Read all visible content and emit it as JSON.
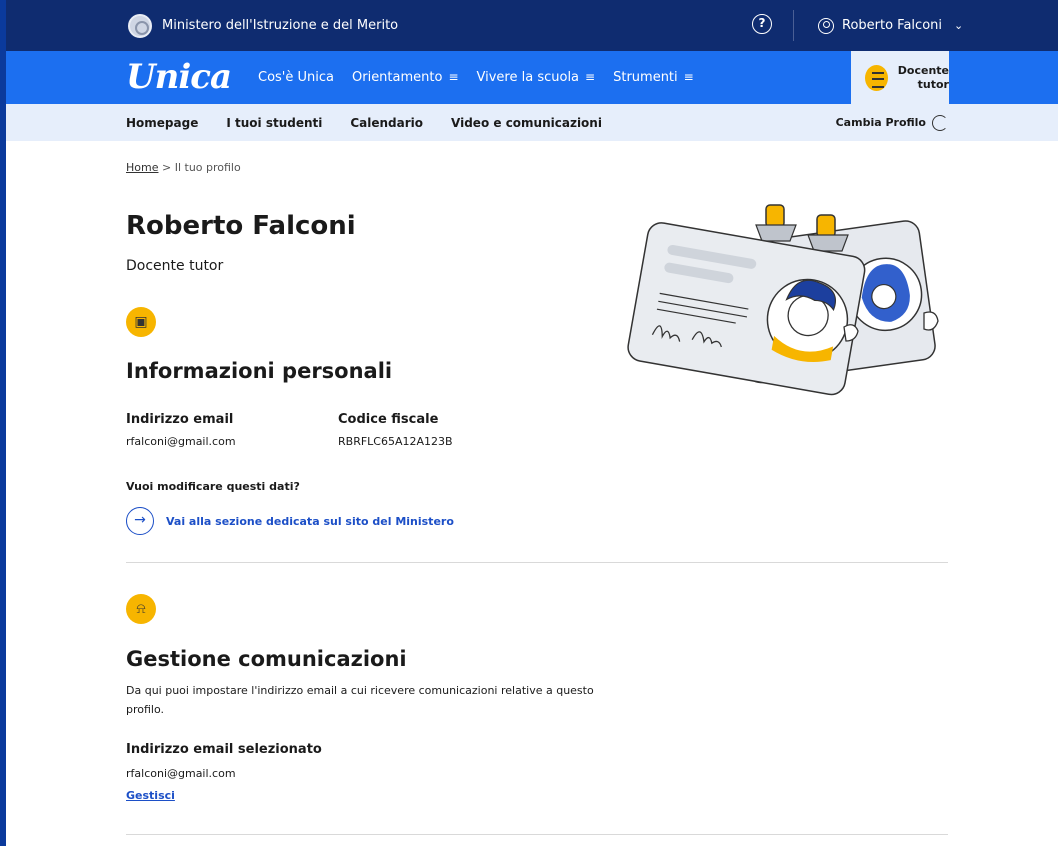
{
  "topbar": {
    "ministry": "Ministero dell'Istruzione e del Merito",
    "help_icon": "?",
    "user_name": "Roberto Falconi"
  },
  "navbar": {
    "logo": "Unica",
    "menu": [
      {
        "label": "Cos'è Unica",
        "hamburger": ""
      },
      {
        "label": "Orientamento",
        "hamburger": "≡"
      },
      {
        "label": "Vivere la scuola",
        "hamburger": "≡"
      },
      {
        "label": "Strumenti",
        "hamburger": "≡"
      }
    ],
    "profile_line1": "Docente",
    "profile_line2": "tutor"
  },
  "subnav": {
    "items": [
      "Homepage",
      "I tuoi studenti",
      "Calendario",
      "Video e comunicazioni"
    ],
    "cambia_profilo": "Cambia Profilo"
  },
  "breadcrumb": {
    "home": "Home",
    "separator": ">",
    "current": "Il tuo profilo"
  },
  "profile": {
    "name": "Roberto Falconi",
    "role": "Docente tutor"
  },
  "personal_info": {
    "title": "Informazioni personali",
    "email_label": "Indirizzo email",
    "email_value": "rfalconi@gmail.com",
    "cf_label": "Codice fiscale",
    "cf_value": "RBRFLC65A12A123B",
    "edit_question": "Vuoi modificare questi dati?",
    "edit_link": "Vai alla sezione dedicata sul sito del Ministero"
  },
  "communications": {
    "title": "Gestione comunicazioni",
    "description": "Da qui puoi impostare l'indirizzo email a cui ricevere comunicazioni relative a questo profilo.",
    "selected_label": "Indirizzo email selezionato",
    "selected_value": "rfalconi@gmail.com",
    "manage_link": "Gestisci"
  },
  "colors": {
    "topbar": "#0f2c70",
    "navbar": "#1c6ff0",
    "subnav": "#e6eefb",
    "accent": "#f7b500",
    "link": "#1c4fc7"
  },
  "icons": {
    "emblem": "italian-republic-emblem",
    "help": "help-circle-icon",
    "user": "user-circle-icon",
    "profile": "docente-tutor-icon",
    "cambia": "switch-profile-icon",
    "personal": "id-card-icon",
    "communications": "bell-icon",
    "arrow": "arrow-right-icon"
  }
}
